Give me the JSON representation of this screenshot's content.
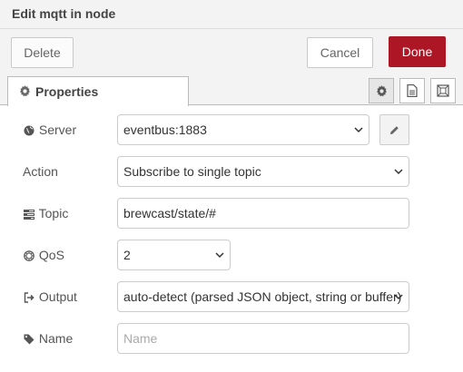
{
  "tray": {
    "title": "Edit mqtt in node"
  },
  "toolbar": {
    "delete_label": "Delete",
    "cancel_label": "Cancel",
    "done_label": "Done"
  },
  "tabs": {
    "properties_label": "Properties",
    "icons": [
      "gear-icon",
      "document-icon",
      "frame-icon"
    ]
  },
  "form": {
    "server": {
      "label": "Server",
      "value": "eventbus:1883",
      "icon": "globe-icon"
    },
    "action": {
      "label": "Action",
      "value": "Subscribe to single topic"
    },
    "topic": {
      "label": "Topic",
      "value": "brewcast/state/#",
      "icon": "tasks-icon"
    },
    "qos": {
      "label": "QoS",
      "value": "2",
      "icon": "empire-icon"
    },
    "output": {
      "label": "Output",
      "value": "auto-detect (parsed JSON object, string or buffer)",
      "icon": "sign-out-icon"
    },
    "name": {
      "label": "Name",
      "placeholder": "Name",
      "icon": "tag-icon"
    }
  },
  "colors": {
    "done_button": "#ad1625",
    "panel_background": "#f3f3f3"
  }
}
